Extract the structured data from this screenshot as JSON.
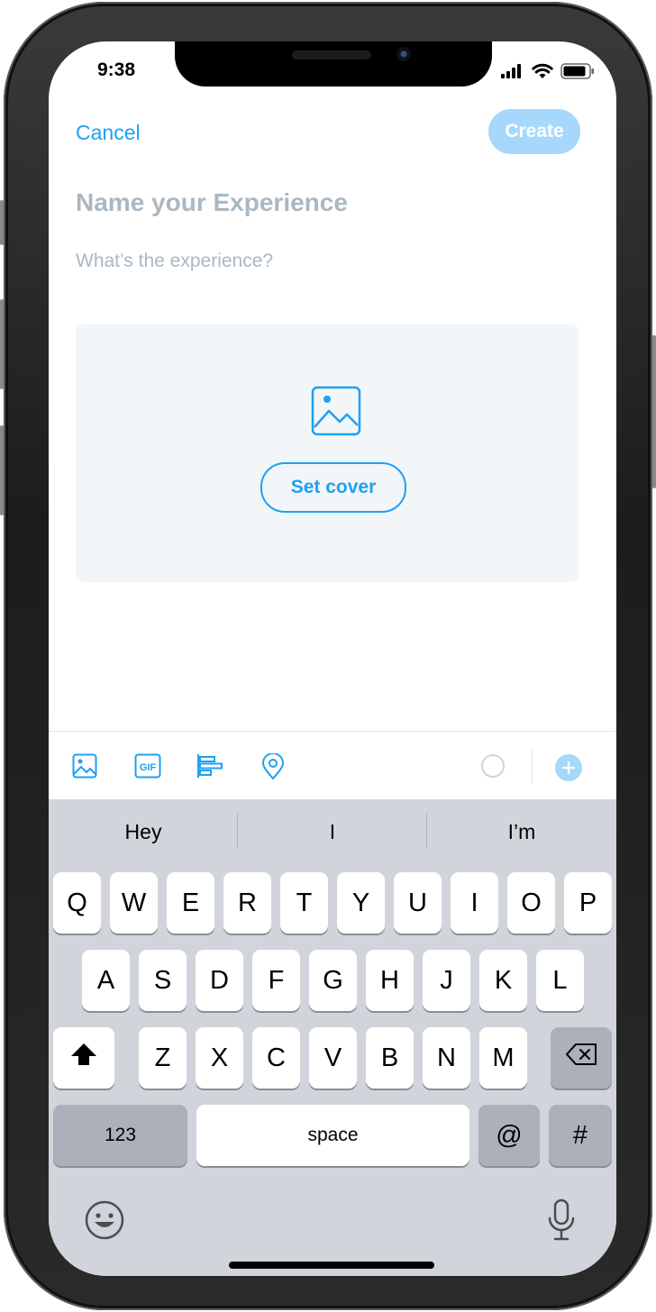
{
  "status_bar": {
    "time": "9:38"
  },
  "nav": {
    "cancel_label": "Cancel",
    "create_label": "Create"
  },
  "form": {
    "title_placeholder": "Name your Experience",
    "description_placeholder": "What’s the experience?",
    "set_cover_label": "Set cover"
  },
  "toolbar": {
    "icons": [
      "image-icon",
      "gif-icon",
      "poll-icon",
      "location-icon",
      "progress-ring-icon",
      "add-thread-icon"
    ],
    "gif_label": "GIF"
  },
  "keyboard": {
    "suggestions": [
      "Hey",
      "I",
      "I’m"
    ],
    "row1": [
      "Q",
      "W",
      "E",
      "R",
      "T",
      "Y",
      "U",
      "I",
      "O",
      "P"
    ],
    "row2": [
      "A",
      "S",
      "D",
      "F",
      "G",
      "H",
      "J",
      "K",
      "L"
    ],
    "row3": [
      "Z",
      "X",
      "C",
      "V",
      "B",
      "N",
      "M"
    ],
    "numbers_label": "123",
    "space_label": "space",
    "at_label": "@",
    "hash_label": "#"
  },
  "colors": {
    "accent": "#1da1f2",
    "accent_disabled": "#a5d8fa",
    "placeholder": "#aab8c2",
    "keyboard_bg": "#d1d5db"
  }
}
